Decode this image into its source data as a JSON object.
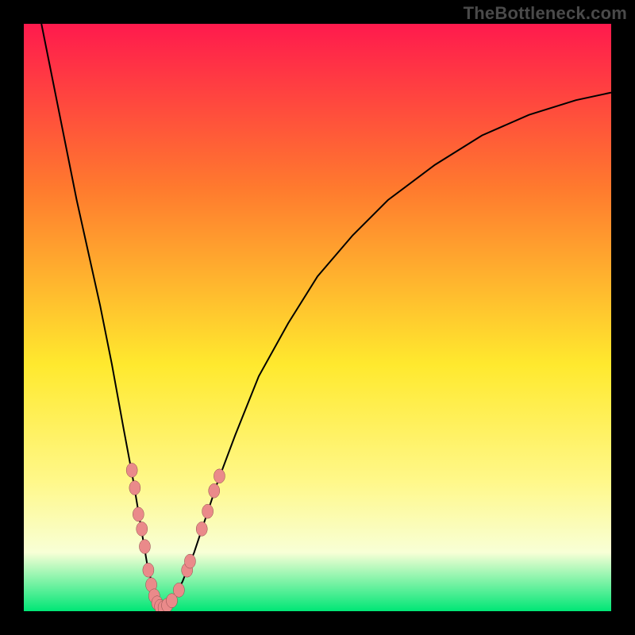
{
  "watermark": "TheBottleneck.com",
  "colors": {
    "frame": "#000000",
    "curve": "#000000",
    "marker_fill": "#ea8a8a",
    "marker_stroke": "#8a4a4a",
    "gradient_top": "#ff1a4d",
    "gradient_mid_upper": "#ff7a2e",
    "gradient_mid": "#ffe92e",
    "gradient_mid_lower": "#fff88a",
    "gradient_band": "#f8ffd6",
    "gradient_bottom": "#00e676"
  },
  "chart_data": {
    "type": "line",
    "title": "",
    "xlabel": "",
    "ylabel": "",
    "xlim": [
      0,
      100
    ],
    "ylim": [
      0,
      100
    ],
    "curve": {
      "x": [
        3,
        5,
        7,
        9,
        11,
        13,
        15,
        17,
        18.5,
        20,
        21,
        22,
        22.8,
        23.4,
        24,
        25,
        27,
        29,
        31,
        33,
        36,
        40,
        45,
        50,
        56,
        62,
        70,
        78,
        86,
        94,
        100
      ],
      "y": [
        100,
        90,
        80,
        70,
        61,
        52,
        42,
        31,
        23,
        14,
        8,
        4,
        1.5,
        0.6,
        0.6,
        1.5,
        5,
        10,
        16,
        22,
        30,
        40,
        49,
        57,
        64,
        70,
        76,
        81,
        84.5,
        87,
        88.3
      ]
    },
    "markers": [
      {
        "x": 18.4,
        "y": 24
      },
      {
        "x": 18.9,
        "y": 21
      },
      {
        "x": 19.5,
        "y": 16.5
      },
      {
        "x": 20.1,
        "y": 14
      },
      {
        "x": 20.6,
        "y": 11
      },
      {
        "x": 21.2,
        "y": 7
      },
      {
        "x": 21.7,
        "y": 4.5
      },
      {
        "x": 22.2,
        "y": 2.6
      },
      {
        "x": 22.7,
        "y": 1.4
      },
      {
        "x": 23.2,
        "y": 0.8
      },
      {
        "x": 23.8,
        "y": 0.6
      },
      {
        "x": 24.4,
        "y": 1.0
      },
      {
        "x": 25.2,
        "y": 1.8
      },
      {
        "x": 26.4,
        "y": 3.6
      },
      {
        "x": 27.8,
        "y": 7.0
      },
      {
        "x": 28.3,
        "y": 8.5
      },
      {
        "x": 30.3,
        "y": 14
      },
      {
        "x": 31.3,
        "y": 17
      },
      {
        "x": 32.4,
        "y": 20.5
      },
      {
        "x": 33.3,
        "y": 23
      }
    ]
  }
}
